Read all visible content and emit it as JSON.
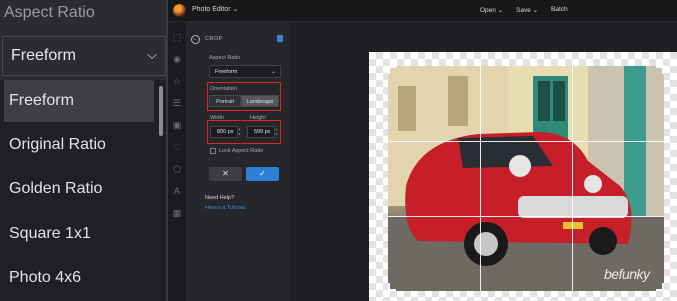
{
  "zoom_panel": {
    "title": "Aspect Ratio",
    "selected_value": "Freeform",
    "options": [
      "Freeform",
      "Original Ratio",
      "Golden Ratio",
      "Square 1x1",
      "Photo 4x6"
    ]
  },
  "topbar": {
    "app_title": "Photo Editor ⌄",
    "menu": {
      "open": "Open ⌄",
      "save": "Save ⌄",
      "batch": "Batch"
    }
  },
  "crop_panel": {
    "header": "CROP",
    "aspect_label": "Aspect Ratio",
    "aspect_value": "Freeform",
    "orientation_label": "Orientation",
    "portrait": "Portrait",
    "landscape": "Landscape",
    "width_label": "Width",
    "height_label": "Height",
    "width_value": "800 px",
    "height_value": "599 px",
    "lock_label": "Lock Aspect Ratio",
    "cancel_glyph": "✕",
    "apply_glyph": "✓",
    "help_title": "Need Help?",
    "help_link": "Here's a Tutorial"
  },
  "canvas": {
    "watermark": "befunky",
    "accent_color": "#2f7fd6",
    "highlight_color": "#d42a2a"
  },
  "icons": [
    "crop-icon",
    "eye-icon",
    "star-icon",
    "layers-icon",
    "frame-icon",
    "heart-icon",
    "shape-icon",
    "text-icon",
    "texture-icon"
  ]
}
